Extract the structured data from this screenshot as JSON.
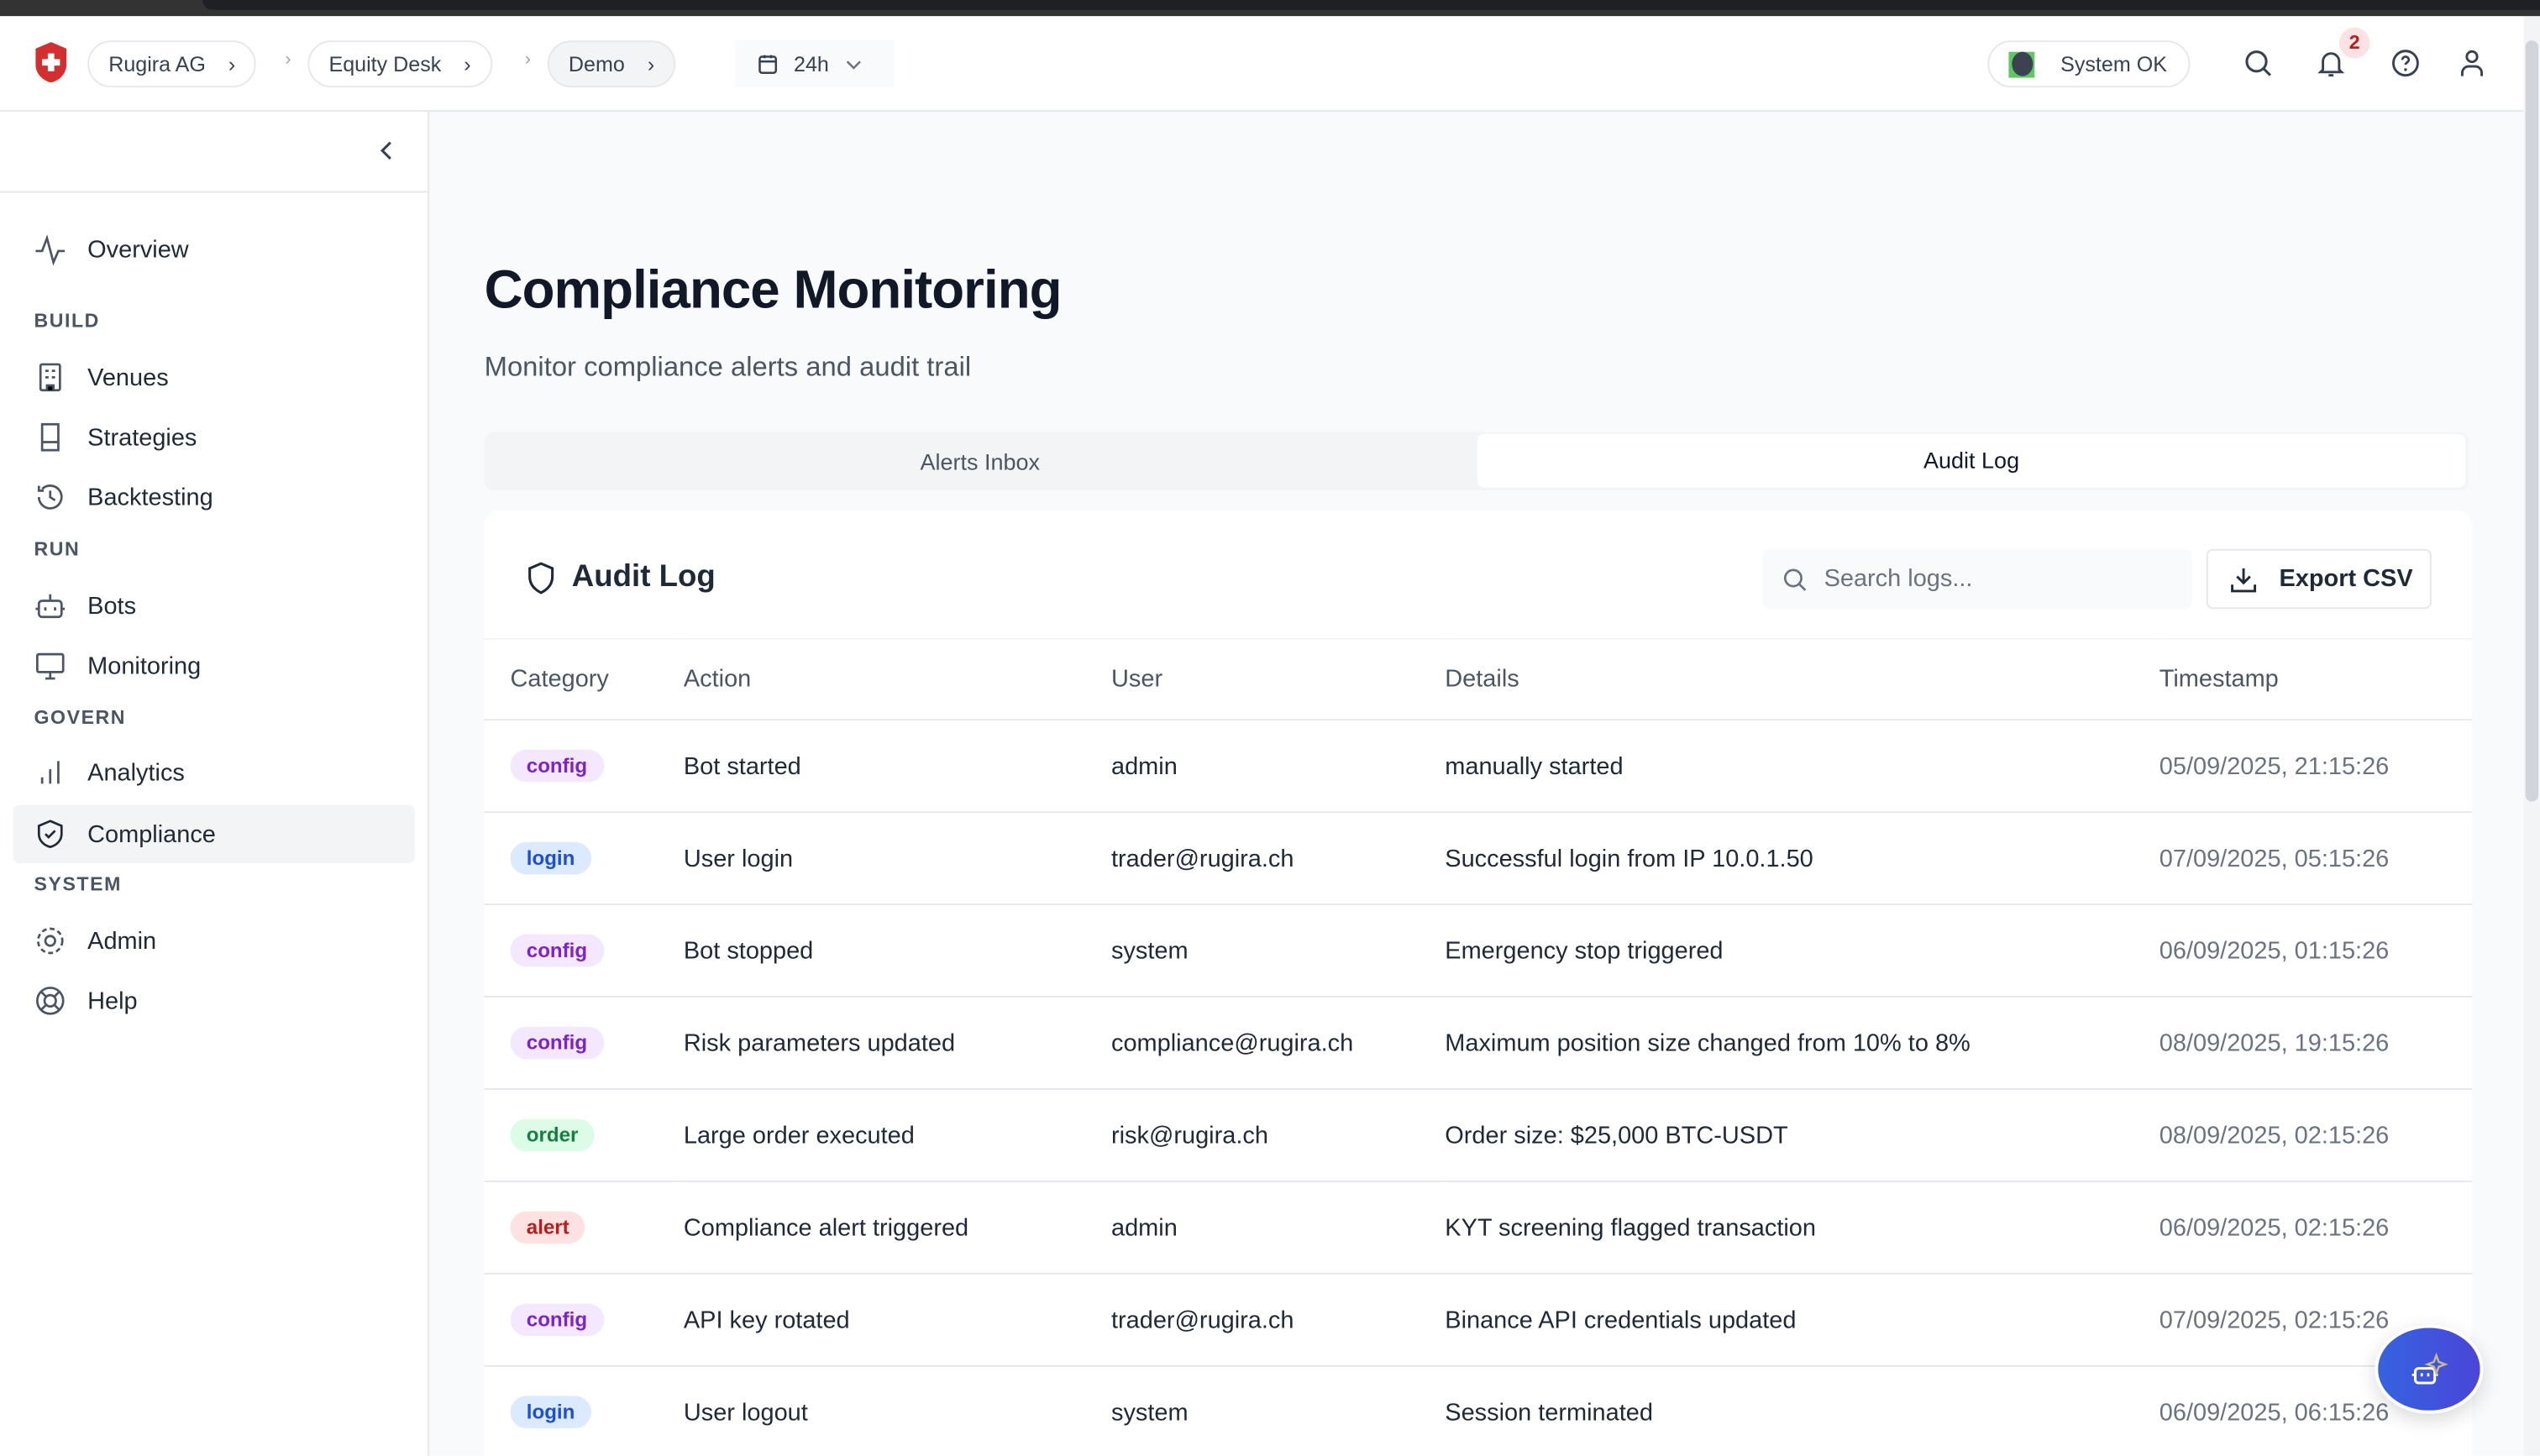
{
  "header": {
    "breadcrumbs": [
      "Rugira AG",
      "Equity Desk",
      "Demo"
    ],
    "time_range": "24h",
    "system_status": "System OK",
    "notification_count": "2",
    "status_color": "#5cc95c",
    "brand_color": "#d32f2f"
  },
  "sidebar": {
    "overview": "Overview",
    "sections": [
      {
        "title": "BUILD",
        "items": [
          "Venues",
          "Strategies",
          "Backtesting"
        ]
      },
      {
        "title": "RUN",
        "items": [
          "Bots",
          "Monitoring"
        ]
      },
      {
        "title": "GOVERN",
        "items": [
          "Analytics",
          "Compliance"
        ]
      },
      {
        "title": "SYSTEM",
        "items": [
          "Admin",
          "Help"
        ]
      }
    ],
    "selected": "Compliance"
  },
  "page": {
    "title": "Compliance Monitoring",
    "subtitle": "Monitor compliance alerts and audit trail",
    "tabs": [
      "Alerts Inbox",
      "Audit Log"
    ],
    "active_tab": "Audit Log"
  },
  "audit": {
    "title": "Audit Log",
    "search_placeholder": "Search logs...",
    "export_label": "Export CSV",
    "columns": [
      "Category",
      "Action",
      "User",
      "Details",
      "Timestamp"
    ],
    "rows": [
      {
        "category": "config",
        "action": "Bot started",
        "user": "admin",
        "details": "manually started",
        "timestamp": "05/09/2025, 21:15:26"
      },
      {
        "category": "login",
        "action": "User login",
        "user": "trader@rugira.ch",
        "details": "Successful login from IP 10.0.1.50",
        "timestamp": "07/09/2025, 05:15:26"
      },
      {
        "category": "config",
        "action": "Bot stopped",
        "user": "system",
        "details": "Emergency stop triggered",
        "timestamp": "06/09/2025, 01:15:26"
      },
      {
        "category": "config",
        "action": "Risk parameters updated",
        "user": "compliance@rugira.ch",
        "details": "Maximum position size changed from 10% to 8%",
        "timestamp": "08/09/2025, 19:15:26"
      },
      {
        "category": "order",
        "action": "Large order executed",
        "user": "risk@rugira.ch",
        "details": "Order size: $25,000 BTC-USDT",
        "timestamp": "08/09/2025, 02:15:26"
      },
      {
        "category": "alert",
        "action": "Compliance alert triggered",
        "user": "admin",
        "details": "KYT screening flagged transaction",
        "timestamp": "06/09/2025, 02:15:26"
      },
      {
        "category": "config",
        "action": "API key rotated",
        "user": "trader@rugira.ch",
        "details": "Binance API credentials updated",
        "timestamp": "07/09/2025, 02:15:26"
      },
      {
        "category": "login",
        "action": "User logout",
        "user": "system",
        "details": "Session terminated",
        "timestamp": "06/09/2025, 06:15:26"
      }
    ],
    "category_colors": {
      "config": {
        "bg": "#f3e8ff",
        "fg": "#7e22ce"
      },
      "login": {
        "bg": "#dbeafe",
        "fg": "#1d4ed8"
      },
      "order": {
        "bg": "#dcfce7",
        "fg": "#15803d"
      },
      "alert": {
        "bg": "#fee2e2",
        "fg": "#b91c1c"
      }
    }
  }
}
